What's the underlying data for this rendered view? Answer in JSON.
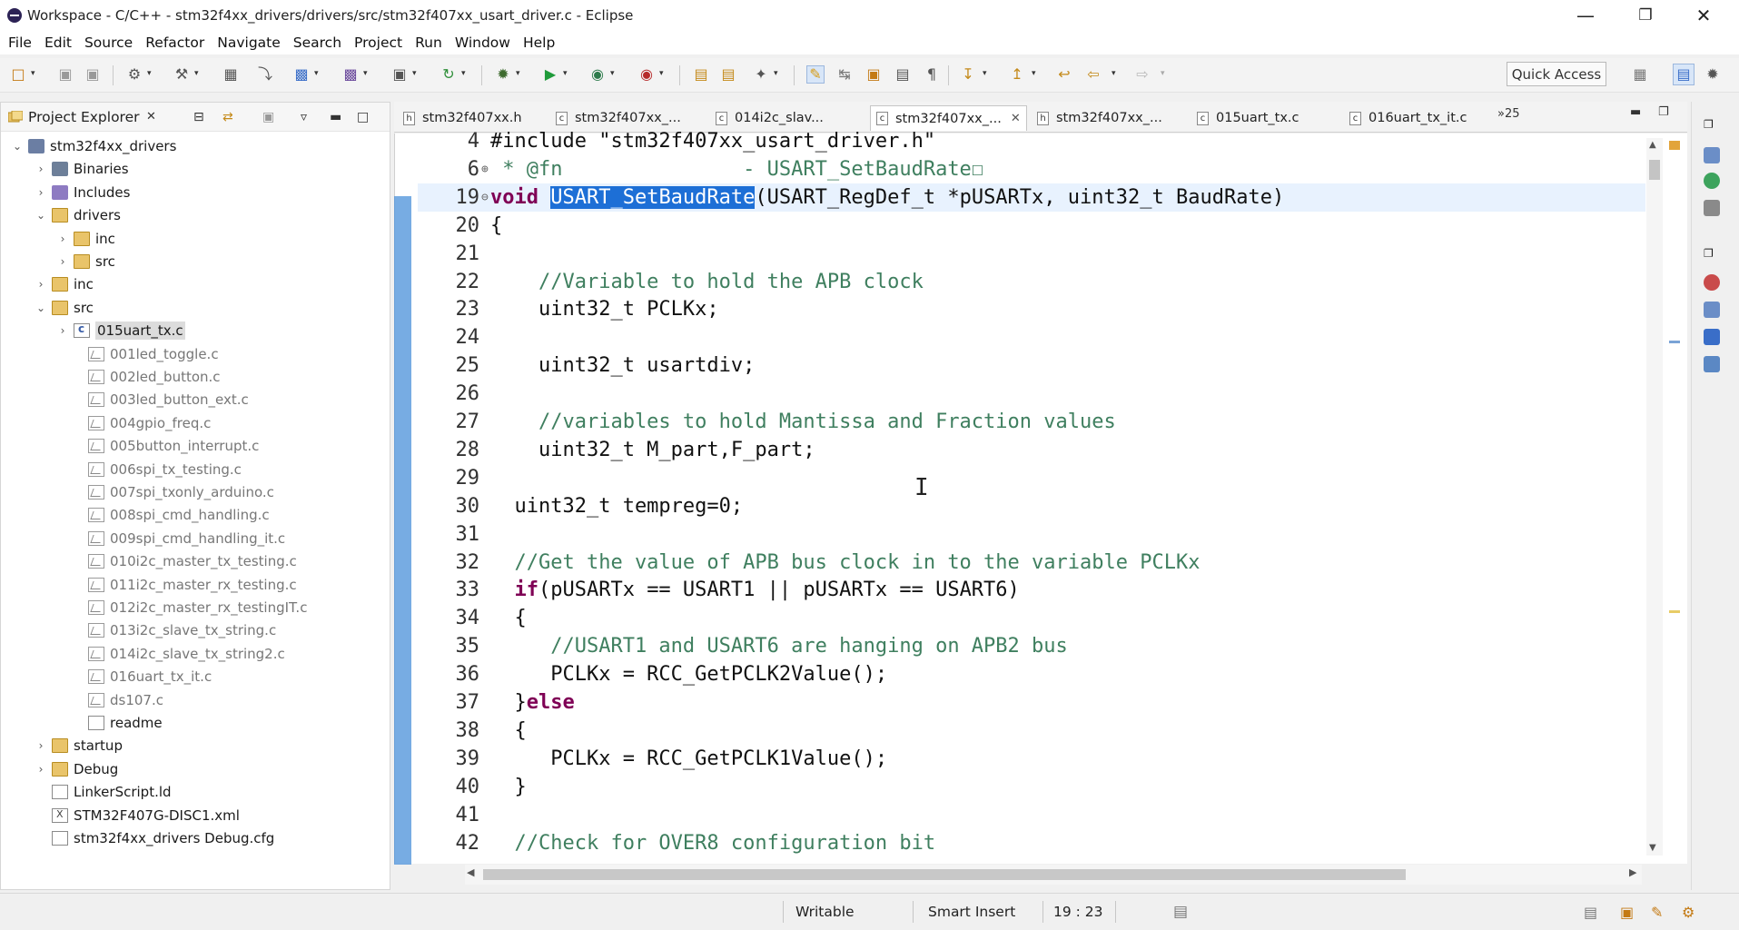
{
  "window": {
    "title": "Workspace - C/C++ - stm32f4xx_drivers/drivers/src/stm32f407xx_usart_driver.c - Eclipse",
    "minimize": "—",
    "maximize": "❐",
    "close": "✕"
  },
  "menu": [
    "File",
    "Edit",
    "Source",
    "Refactor",
    "Navigate",
    "Search",
    "Project",
    "Run",
    "Window",
    "Help"
  ],
  "toolbar": {
    "quick_access": "Quick Access"
  },
  "explorer": {
    "title": "Project Explorer",
    "tree": [
      {
        "label": "stm32f4xx_drivers",
        "arrow": "⌄",
        "icon": "project-icon",
        "dim": false
      },
      {
        "label": "Binaries",
        "arrow": "›",
        "icon": "binaries-icon",
        "dim": false
      },
      {
        "label": "Includes",
        "arrow": "›",
        "icon": "includes-icon",
        "dim": false
      },
      {
        "label": "drivers",
        "arrow": "⌄",
        "icon": "folder-icon",
        "dim": false
      },
      {
        "label": "inc",
        "arrow": "›",
        "icon": "folder-icon",
        "dim": false
      },
      {
        "label": "src",
        "arrow": "›",
        "icon": "folder-icon",
        "dim": false
      },
      {
        "label": "inc",
        "arrow": "›",
        "icon": "folder-icon",
        "dim": false
      },
      {
        "label": "src",
        "arrow": "⌄",
        "icon": "folder-icon",
        "dim": false
      },
      {
        "label": "015uart_tx.c",
        "arrow": "›",
        "icon": "c-file-icon",
        "dim": false
      },
      {
        "label": "001led_toggle.c",
        "arrow": "",
        "icon": "excluded-file-icon",
        "dim": true
      },
      {
        "label": "002led_button.c",
        "arrow": "",
        "icon": "excluded-file-icon",
        "dim": true
      },
      {
        "label": "003led_button_ext.c",
        "arrow": "",
        "icon": "excluded-file-icon",
        "dim": true
      },
      {
        "label": "004gpio_freq.c",
        "arrow": "",
        "icon": "excluded-file-icon",
        "dim": true
      },
      {
        "label": "005button_interrupt.c",
        "arrow": "",
        "icon": "excluded-file-icon",
        "dim": true
      },
      {
        "label": "006spi_tx_testing.c",
        "arrow": "",
        "icon": "excluded-file-icon",
        "dim": true
      },
      {
        "label": "007spi_txonly_arduino.c",
        "arrow": "",
        "icon": "excluded-file-icon",
        "dim": true
      },
      {
        "label": "008spi_cmd_handling.c",
        "arrow": "",
        "icon": "excluded-file-icon",
        "dim": true
      },
      {
        "label": "009spi_cmd_handling_it.c",
        "arrow": "",
        "icon": "excluded-file-icon",
        "dim": true
      },
      {
        "label": "010i2c_master_tx_testing.c",
        "arrow": "",
        "icon": "excluded-file-icon",
        "dim": true
      },
      {
        "label": "011i2c_master_rx_testing.c",
        "arrow": "",
        "icon": "excluded-file-icon",
        "dim": true
      },
      {
        "label": "012i2c_master_rx_testingIT.c",
        "arrow": "",
        "icon": "excluded-file-icon",
        "dim": true
      },
      {
        "label": "013i2c_slave_tx_string.c",
        "arrow": "",
        "icon": "excluded-file-icon",
        "dim": true
      },
      {
        "label": "014i2c_slave_tx_string2.c",
        "arrow": "",
        "icon": "excluded-file-icon",
        "dim": true
      },
      {
        "label": "016uart_tx_it.c",
        "arrow": "",
        "icon": "excluded-file-icon",
        "dim": true
      },
      {
        "label": "ds107.c",
        "arrow": "",
        "icon": "excluded-file-icon",
        "dim": true
      },
      {
        "label": "readme",
        "arrow": "",
        "icon": "file-icon",
        "dim": false
      },
      {
        "label": "startup",
        "arrow": "›",
        "icon": "folder-icon",
        "dim": false
      },
      {
        "label": "Debug",
        "arrow": "›",
        "icon": "folder-icon",
        "dim": false
      },
      {
        "label": "LinkerScript.ld",
        "arrow": "",
        "icon": "file-icon",
        "dim": false
      },
      {
        "label": "STM32F407G-DISC1.xml",
        "arrow": "",
        "icon": "xml-file-icon",
        "dim": false
      },
      {
        "label": "stm32f4xx_drivers Debug.cfg",
        "arrow": "",
        "icon": "file-icon",
        "dim": false
      }
    ]
  },
  "editor": {
    "tabs": [
      {
        "label": "stm32f407xx.h",
        "icon": "h"
      },
      {
        "label": "stm32f407xx_...",
        "icon": "c"
      },
      {
        "label": "014i2c_slav...",
        "icon": "c"
      },
      {
        "label": "stm32f407xx_...",
        "icon": "c",
        "active": true
      },
      {
        "label": "stm32f407xx_...",
        "icon": "h"
      },
      {
        "label": "015uart_tx.c",
        "icon": "c"
      },
      {
        "label": "016uart_tx_it.c",
        "icon": "c"
      }
    ],
    "tabs_more": "»25",
    "lines": [
      {
        "n": "4",
        "fold": "",
        "parts": [
          [
            "",
            "#include \"stm32f407xx_usart_driver.h\""
          ]
        ]
      },
      {
        "n": "6",
        "fold": "⊕",
        "parts": [
          [
            "cm",
            " * @fn               - USART_SetBaudRate☐"
          ]
        ]
      },
      {
        "n": "19",
        "fold": "⊖",
        "parts": [
          [
            "kw",
            "void"
          ],
          [
            "",
            " "
          ],
          [
            "sel",
            "USART_SetBaudRate"
          ],
          [
            "",
            "(USART_RegDef_t *pUSARTx, uint32_t BaudRate)"
          ]
        ]
      },
      {
        "n": "20",
        "fold": "",
        "parts": [
          [
            "",
            "{"
          ]
        ]
      },
      {
        "n": "21",
        "fold": "",
        "parts": [
          [
            "",
            ""
          ]
        ]
      },
      {
        "n": "22",
        "fold": "",
        "parts": [
          [
            "cm",
            "    //Variable to hold the APB clock"
          ]
        ]
      },
      {
        "n": "23",
        "fold": "",
        "parts": [
          [
            "",
            "    uint32_t PCLKx;"
          ]
        ]
      },
      {
        "n": "24",
        "fold": "",
        "parts": [
          [
            "",
            ""
          ]
        ]
      },
      {
        "n": "25",
        "fold": "",
        "parts": [
          [
            "",
            "    uint32_t usartdiv;"
          ]
        ]
      },
      {
        "n": "26",
        "fold": "",
        "parts": [
          [
            "",
            ""
          ]
        ]
      },
      {
        "n": "27",
        "fold": "",
        "parts": [
          [
            "cm",
            "    //variables to hold Mantissa and Fraction values"
          ]
        ]
      },
      {
        "n": "28",
        "fold": "",
        "parts": [
          [
            "",
            "    uint32_t M_part,F_part;"
          ]
        ]
      },
      {
        "n": "29",
        "fold": "",
        "parts": [
          [
            "",
            ""
          ]
        ]
      },
      {
        "n": "30",
        "fold": "",
        "parts": [
          [
            "",
            "  uint32_t tempreg=0;"
          ]
        ]
      },
      {
        "n": "31",
        "fold": "",
        "parts": [
          [
            "",
            ""
          ]
        ]
      },
      {
        "n": "32",
        "fold": "",
        "parts": [
          [
            "cm",
            "  //Get the value of APB bus clock in to the variable PCLKx"
          ]
        ]
      },
      {
        "n": "33",
        "fold": "",
        "parts": [
          [
            "kw",
            "  if"
          ],
          [
            "",
            "(pUSARTx == USART1 || pUSARTx == USART6)"
          ]
        ]
      },
      {
        "n": "34",
        "fold": "",
        "parts": [
          [
            "",
            "  {"
          ]
        ]
      },
      {
        "n": "35",
        "fold": "",
        "parts": [
          [
            "cm",
            "     //USART1 and USART6 are hanging on APB2 bus"
          ]
        ]
      },
      {
        "n": "36",
        "fold": "",
        "parts": [
          [
            "",
            "     PCLKx = RCC_GetPCLK2Value();"
          ]
        ]
      },
      {
        "n": "37",
        "fold": "",
        "parts": [
          [
            "",
            "  }"
          ],
          [
            "kw",
            "else"
          ]
        ]
      },
      {
        "n": "38",
        "fold": "",
        "parts": [
          [
            "",
            "  {"
          ]
        ]
      },
      {
        "n": "39",
        "fold": "",
        "parts": [
          [
            "",
            "     PCLKx = RCC_GetPCLK1Value();"
          ]
        ]
      },
      {
        "n": "40",
        "fold": "",
        "parts": [
          [
            "",
            "  }"
          ]
        ]
      },
      {
        "n": "41",
        "fold": "",
        "parts": [
          [
            "",
            ""
          ]
        ]
      },
      {
        "n": "42",
        "fold": "",
        "parts": [
          [
            "cm",
            "  //Check for OVER8 configuration bit"
          ]
        ]
      }
    ]
  },
  "status": {
    "writable": "Writable",
    "insert_mode": "Smart Insert",
    "position": "19 : 23"
  },
  "colors": {
    "selection": "#1d6fd6",
    "keyword": "#7f0055",
    "comment": "#3f7f5f",
    "marker": "#4a90d9"
  }
}
